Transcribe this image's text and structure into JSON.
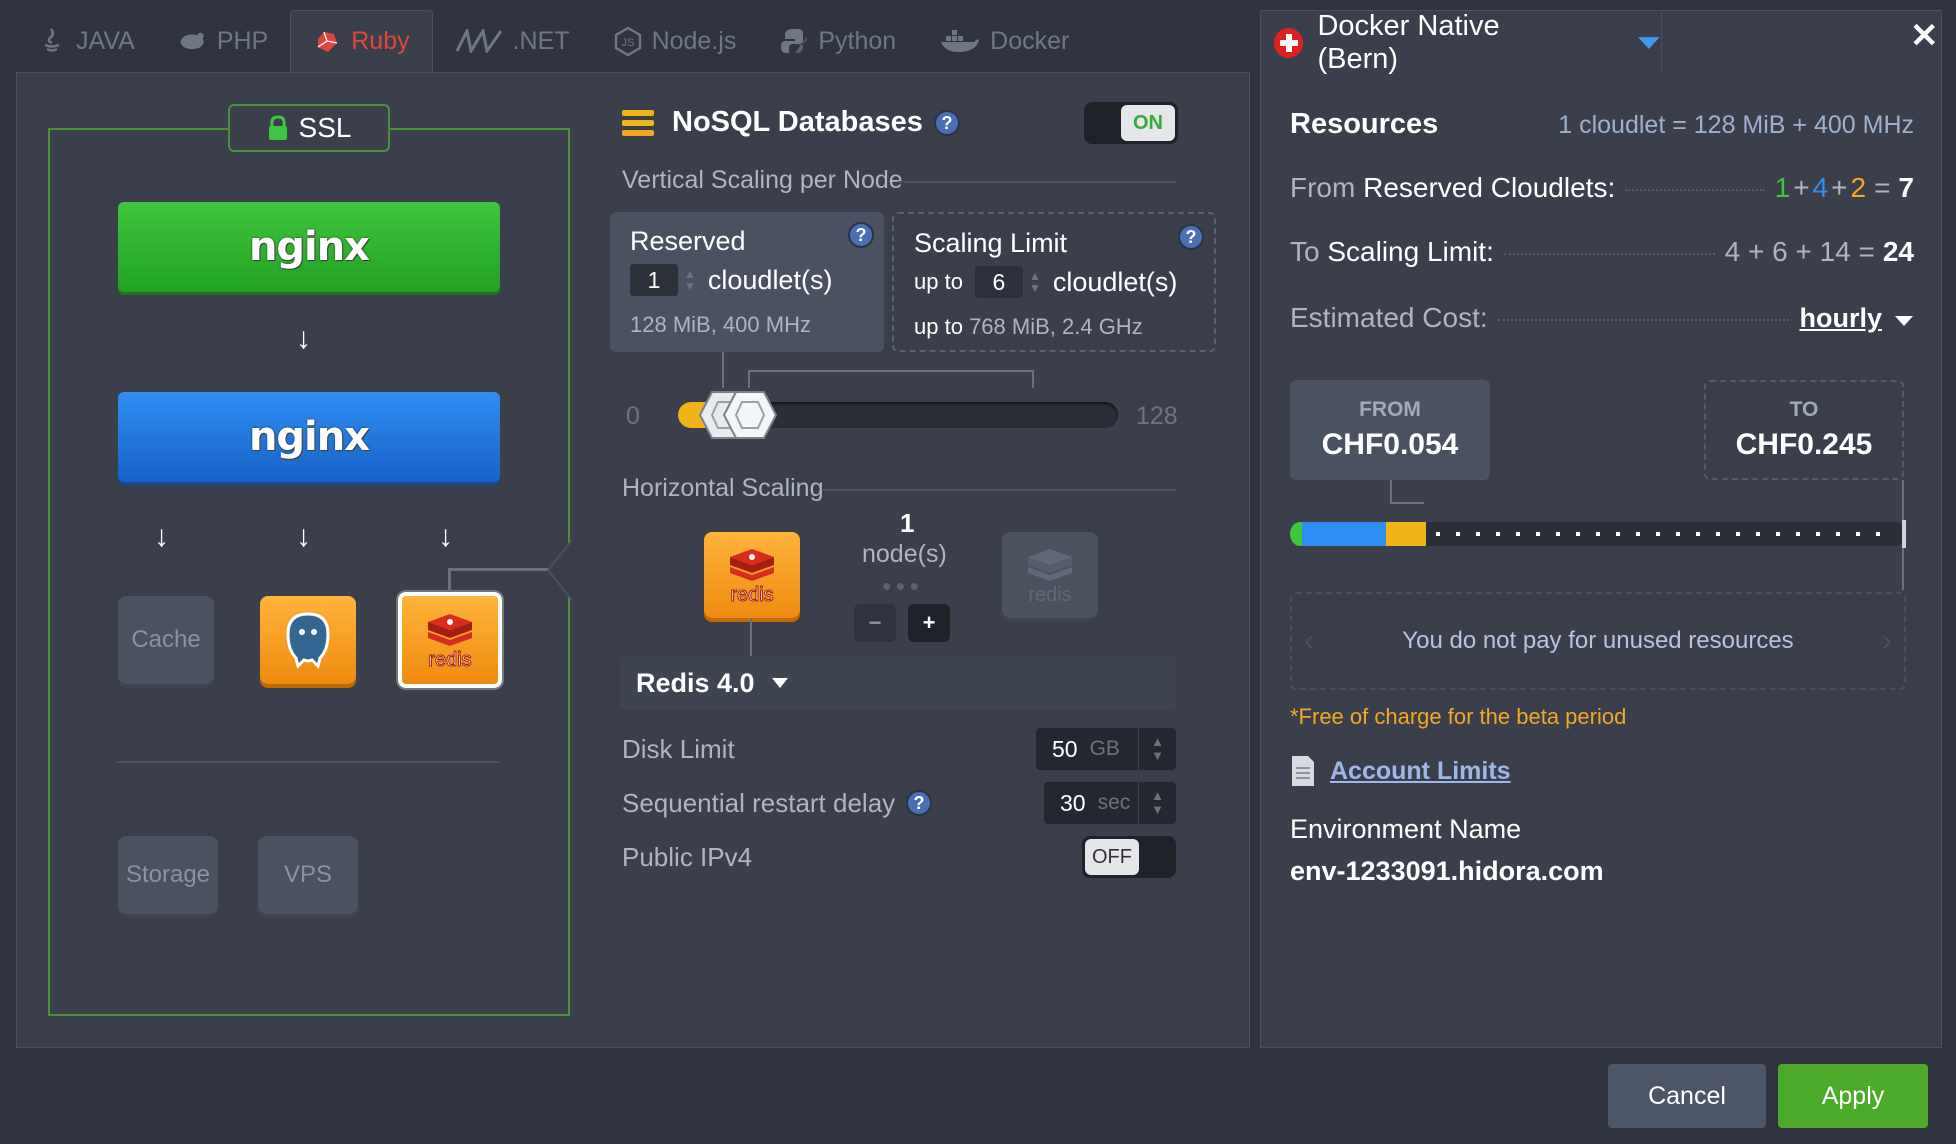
{
  "tabs": [
    {
      "label": "JAVA",
      "icon": "java-icon"
    },
    {
      "label": "PHP",
      "icon": "php-icon"
    },
    {
      "label": "Ruby",
      "icon": "ruby-icon",
      "active": true
    },
    {
      "label": ".NET",
      "icon": "dotnet-icon"
    },
    {
      "label": "Node.js",
      "icon": "nodejs-icon"
    },
    {
      "label": "Python",
      "icon": "python-icon"
    },
    {
      "label": "Docker",
      "icon": "docker-icon"
    }
  ],
  "topology": {
    "ssl_label": "SSL",
    "balancer_logo": "nginx",
    "app_server_logo": "nginx",
    "cache_label": "Cache",
    "sql_icon": "postgresql-icon",
    "nosql_icon": "redis-icon",
    "nosql_logo_text": "redis",
    "storage_label": "Storage",
    "vps_label": "VPS"
  },
  "settings": {
    "section_title": "NoSQL Databases",
    "toggle": "ON",
    "vertical_title": "Vertical Scaling per Node",
    "reserved": {
      "title": "Reserved",
      "value": "1",
      "unit": "cloudlet(s)",
      "specs": "128 MiB, 400 MHz"
    },
    "scaling_limit": {
      "title": "Scaling Limit",
      "prefix": "up to",
      "value": "6",
      "unit": "cloudlet(s)",
      "specs_prefix": "up to",
      "specs": "768 MiB, 2.4 GHz"
    },
    "slider": {
      "min": "0",
      "max": "128",
      "reserved": 1,
      "limit": 6
    },
    "horizontal_title": "Horizontal Scaling",
    "nodes_count": "1",
    "nodes_label": "node(s)",
    "minus": "−",
    "plus": "+",
    "version": "Redis 4.0",
    "disk_limit_label": "Disk Limit",
    "disk_limit_value": "50",
    "disk_limit_unit": "GB",
    "restart_delay_label": "Sequential restart delay",
    "restart_delay_value": "30",
    "restart_delay_unit": "sec",
    "ipv4_label": "Public IPv4",
    "ipv4_toggle": "OFF"
  },
  "resources": {
    "region": "Docker Native (Bern)",
    "title": "Resources",
    "cloudlet_def": "1 cloudlet = 128 MiB + 400 MHz",
    "from_label_a": "From",
    "from_label_b": "Reserved Cloudlets:",
    "from_parts": [
      "1",
      "+",
      "4",
      "+",
      "2",
      "="
    ],
    "from_total": "7",
    "to_label_a": "To",
    "to_label_b": "Scaling Limit:",
    "to_parts": "4 + 6 + 14 =",
    "to_total": "24",
    "cost_label": "Estimated Cost:",
    "cost_period": "hourly",
    "from_price_label": "FROM",
    "from_price": "CHF0.054",
    "to_price_label": "TO",
    "to_price": "CHF0.245",
    "notice": "You do not pay for unused resources",
    "beta": "*Free of charge for the beta period",
    "account_limits": "Account Limits",
    "env_label": "Environment Name",
    "env_name": "env-1233091.hidora.com",
    "colors": {
      "green": "#3fc63f",
      "blue": "#2f8ef2",
      "orange": "#f5a623",
      "apply": "#4caa2a"
    }
  },
  "footer": {
    "cancel": "Cancel",
    "apply": "Apply"
  }
}
